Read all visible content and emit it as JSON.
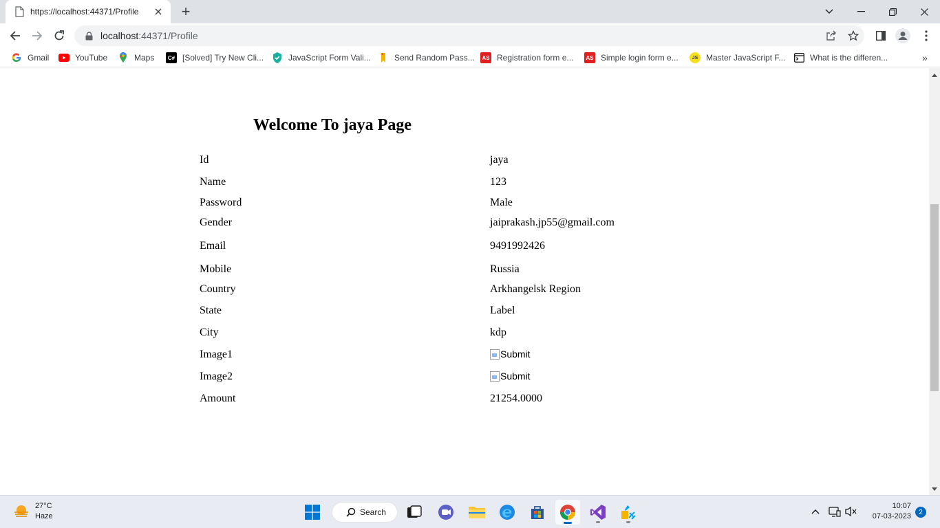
{
  "browser": {
    "tab": {
      "title": "https://localhost:44371/Profile",
      "favicon": "page-icon"
    },
    "new_tab_label": "+",
    "address": {
      "host": "localhost",
      "rest": ":44371/Profile"
    },
    "bookmarks": [
      {
        "label": "Gmail",
        "icon": "google-icon"
      },
      {
        "label": "YouTube",
        "icon": "youtube-icon"
      },
      {
        "label": "Maps",
        "icon": "maps-icon"
      },
      {
        "label": "[Solved] Try New Cli...",
        "icon": "csharp-corner-icon"
      },
      {
        "label": "JavaScript Form Vali...",
        "icon": "shield-icon"
      },
      {
        "label": "Send Random Pass...",
        "icon": "bookmark-icon"
      },
      {
        "label": "Registration form e...",
        "icon": "w3-icon"
      },
      {
        "label": "Simple login form e...",
        "icon": "w3-icon"
      },
      {
        "label": "Master JavaScript F...",
        "icon": "js-icon"
      },
      {
        "label": "What is the differen...",
        "icon": "terminal-icon"
      }
    ],
    "bookmarks_overflow": "»"
  },
  "page": {
    "title": "Welcome To jaya Page",
    "rows": [
      {
        "label": "Id",
        "value": "jaya"
      },
      {
        "label": "Name",
        "value": "123"
      },
      {
        "label": "Password",
        "value": "Male"
      },
      {
        "label": "Gender",
        "value": "jaiprakash.jp55@gmail.com"
      },
      {
        "label": "Email",
        "value": "9491992426"
      },
      {
        "label": "Mobile",
        "value": "Russia"
      },
      {
        "label": "Country",
        "value": "Arkhangelsk Region"
      },
      {
        "label": "State",
        "value": "Label"
      },
      {
        "label": "City",
        "value": "kdp"
      },
      {
        "label": "Image1",
        "value": "Submit",
        "broken_image": true
      },
      {
        "label": "Image2",
        "value": "Submit",
        "broken_image": true
      },
      {
        "label": "Amount",
        "value": "21254.0000"
      }
    ]
  },
  "taskbar": {
    "weather": {
      "temp": "27°C",
      "condition": "Haze"
    },
    "search_label": "Search",
    "clock": {
      "time": "10:07",
      "date": "07-03-2023"
    },
    "notifications": "2"
  },
  "colors": {
    "tabstrip": "#dee1e6",
    "omnibox": "#f1f3f4",
    "taskbar": "#e8ecf2",
    "accent": "#0067c0"
  }
}
